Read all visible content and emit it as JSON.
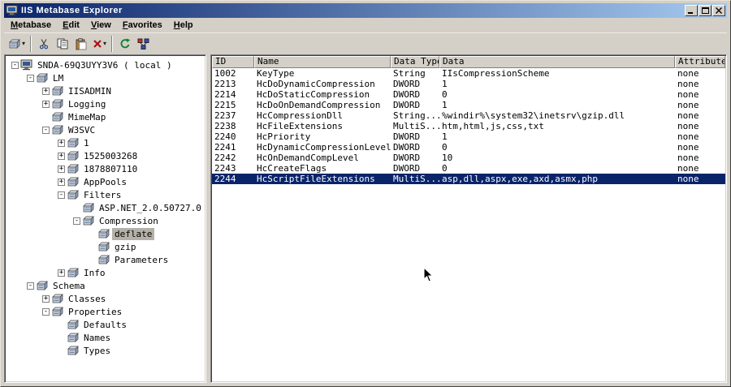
{
  "window": {
    "title": "IIS Metabase Explorer"
  },
  "menu": {
    "items": [
      {
        "label": "Metabase",
        "underline": 0
      },
      {
        "label": "Edit",
        "underline": 0
      },
      {
        "label": "View",
        "underline": 0
      },
      {
        "label": "Favorites",
        "underline": 0
      },
      {
        "label": "Help",
        "underline": 0
      }
    ]
  },
  "toolbar": {
    "buttons": [
      {
        "name": "new-key-button",
        "icon": "key-icon",
        "dropdown": true
      },
      {
        "type": "separator"
      },
      {
        "name": "cut-button",
        "icon": "cut-icon"
      },
      {
        "name": "copy-button",
        "icon": "copy-icon"
      },
      {
        "name": "paste-button",
        "icon": "paste-icon"
      },
      {
        "name": "delete-button",
        "icon": "delete-icon",
        "dropdown": true
      },
      {
        "type": "separator"
      },
      {
        "name": "refresh-button",
        "icon": "refresh-icon"
      },
      {
        "name": "connect-button",
        "icon": "network-icon"
      }
    ]
  },
  "tree": {
    "nodes": [
      {
        "label": "SNDA-69Q3UYY3V6 ( local )",
        "depth": 0,
        "expander": "-",
        "icon": "computer-icon"
      },
      {
        "label": "LM",
        "depth": 1,
        "expander": "-",
        "icon": "key-icon"
      },
      {
        "label": "IISADMIN",
        "depth": 2,
        "expander": "+",
        "icon": "key-icon"
      },
      {
        "label": "Logging",
        "depth": 2,
        "expander": "+",
        "icon": "key-icon"
      },
      {
        "label": "MimeMap",
        "depth": 2,
        "expander": null,
        "icon": "key-icon"
      },
      {
        "label": "W3SVC",
        "depth": 2,
        "expander": "-",
        "icon": "key-icon"
      },
      {
        "label": "1",
        "depth": 3,
        "expander": "+",
        "icon": "key-icon"
      },
      {
        "label": "1525003268",
        "depth": 3,
        "expander": "+",
        "icon": "key-icon"
      },
      {
        "label": "1878807110",
        "depth": 3,
        "expander": "+",
        "icon": "key-icon"
      },
      {
        "label": "AppPools",
        "depth": 3,
        "expander": "+",
        "icon": "key-icon"
      },
      {
        "label": "Filters",
        "depth": 3,
        "expander": "-",
        "icon": "key-icon"
      },
      {
        "label": "ASP.NET_2.0.50727.0",
        "depth": 4,
        "expander": null,
        "icon": "key-icon"
      },
      {
        "label": "Compression",
        "depth": 4,
        "expander": "-",
        "icon": "key-icon"
      },
      {
        "label": "deflate",
        "depth": 5,
        "expander": null,
        "icon": "key-icon",
        "selected": true
      },
      {
        "label": "gzip",
        "depth": 5,
        "expander": null,
        "icon": "key-icon"
      },
      {
        "label": "Parameters",
        "depth": 5,
        "expander": null,
        "icon": "key-icon"
      },
      {
        "label": "Info",
        "depth": 3,
        "expander": "+",
        "icon": "key-icon"
      },
      {
        "label": "Schema",
        "depth": 1,
        "expander": "-",
        "icon": "key-icon"
      },
      {
        "label": "Classes",
        "depth": 2,
        "expander": "+",
        "icon": "key-icon"
      },
      {
        "label": "Properties",
        "depth": 2,
        "expander": "-",
        "icon": "key-icon"
      },
      {
        "label": "Defaults",
        "depth": 3,
        "expander": null,
        "icon": "key-icon"
      },
      {
        "label": "Names",
        "depth": 3,
        "expander": null,
        "icon": "key-icon"
      },
      {
        "label": "Types",
        "depth": 3,
        "expander": null,
        "icon": "key-icon"
      }
    ]
  },
  "table": {
    "columns": [
      "ID",
      "Name",
      "Data Type",
      "Data",
      "Attributes"
    ],
    "rows": [
      [
        "1002",
        "KeyType",
        "String",
        "IIsCompressionScheme",
        "none"
      ],
      [
        "2213",
        "HcDoDynamicCompression",
        "DWORD",
        "1",
        "none"
      ],
      [
        "2214",
        "HcDoStaticCompression",
        "DWORD",
        "0",
        "none"
      ],
      [
        "2215",
        "HcDoOnDemandCompression",
        "DWORD",
        "1",
        "none"
      ],
      [
        "2237",
        "HcCompressionDll",
        "String...",
        "%windir%\\system32\\inetsrv\\gzip.dll",
        "none"
      ],
      [
        "2238",
        "HcFileExtensions",
        "MultiS...",
        "htm,html,js,css,txt",
        "none"
      ],
      [
        "2240",
        "HcPriority",
        "DWORD",
        "1",
        "none"
      ],
      [
        "2241",
        "HcDynamicCompressionLevel",
        "DWORD",
        "0",
        "none"
      ],
      [
        "2242",
        "HcOnDemandCompLevel",
        "DWORD",
        "10",
        "none"
      ],
      [
        "2243",
        "HcCreateFlags",
        "DWORD",
        "0",
        "none"
      ],
      [
        "2244",
        "HcScriptFileExtensions",
        "MultiS...",
        "asp,dll,aspx,exe,axd,asmx,php",
        "none"
      ]
    ],
    "selected_row_index": 10
  },
  "colors": {
    "title_gradient_start": "#0a246a",
    "title_gradient_end": "#a6caf0",
    "chrome": "#d4d0c8",
    "selection_active": "#0a246a",
    "selection_inactive": "#b5b1a8"
  }
}
